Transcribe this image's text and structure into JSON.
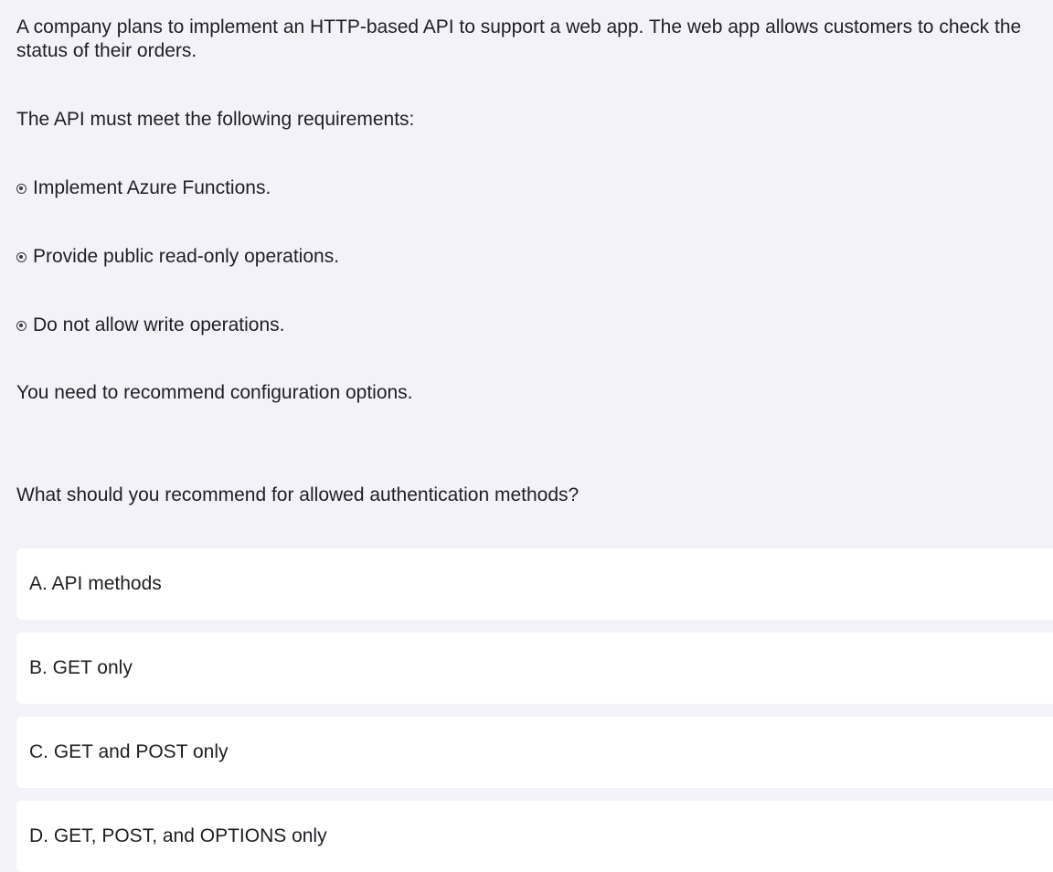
{
  "question": {
    "intro": "A company plans to implement an HTTP-based API to support a web app. The web app allows customers to check the status of their orders.",
    "requirements_heading": "The API must meet the following requirements:",
    "requirements": [
      "Implement Azure Functions.",
      "Provide public read-only operations.",
      "Do not allow write operations."
    ],
    "task": "You need to recommend configuration options.",
    "prompt": "What should you recommend for allowed authentication methods?"
  },
  "options": [
    {
      "letter": "A",
      "label": "A. API methods"
    },
    {
      "letter": "B",
      "label": "B. GET only"
    },
    {
      "letter": "C",
      "label": "C. GET and POST only"
    },
    {
      "letter": "D",
      "label": "D. GET, POST, and OPTIONS only"
    }
  ],
  "colors": {
    "background": "#f3f2f8",
    "option_background": "#ffffff",
    "text": "#1f1f24"
  },
  "icons": {
    "bullet": "radio-bullet-icon"
  }
}
